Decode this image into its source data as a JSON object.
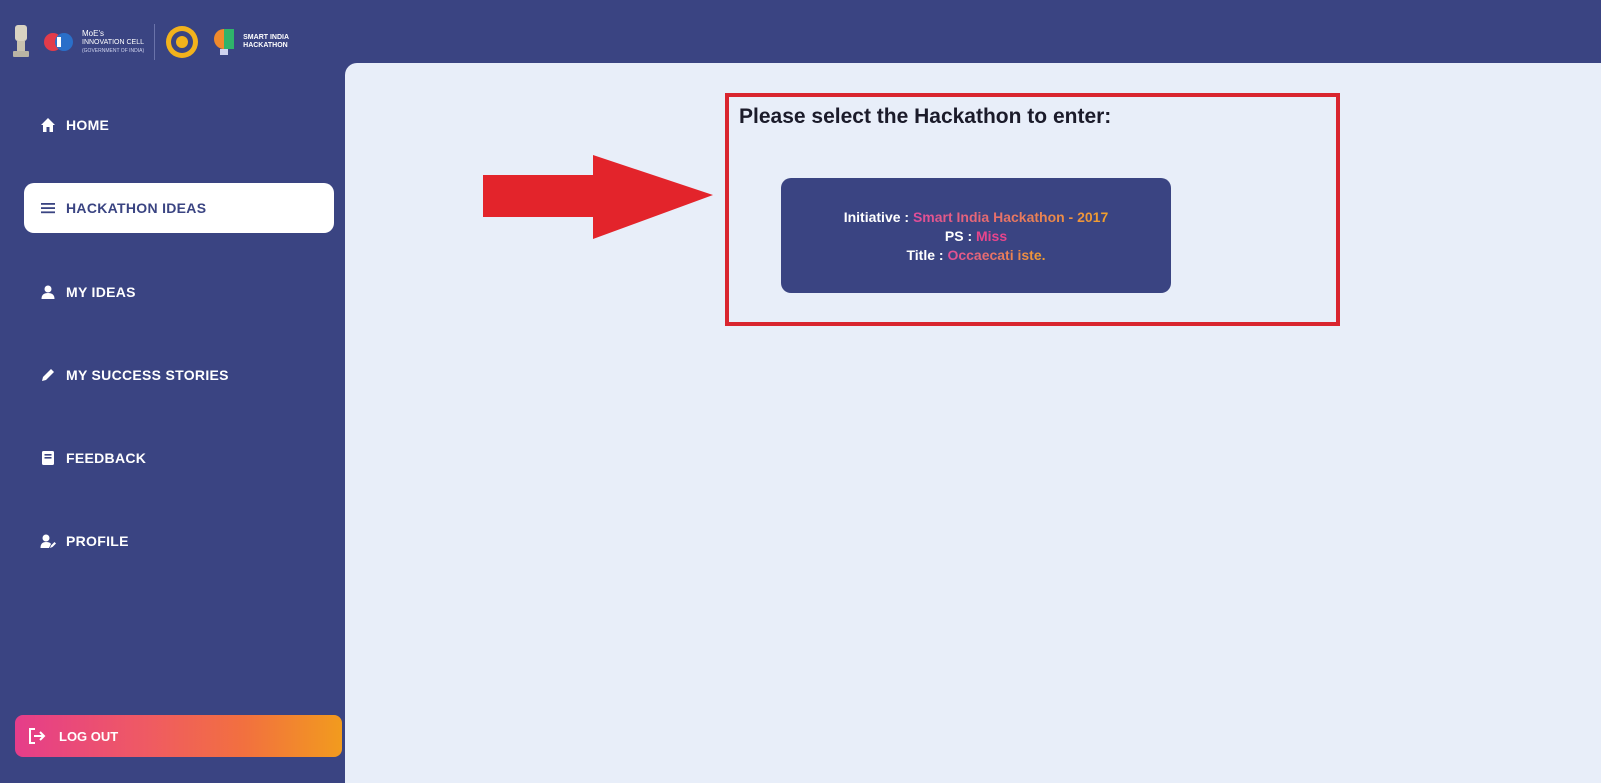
{
  "header": {
    "logos": {
      "moe_line1": "MoE's",
      "moe_line2": "INNOVATION CELL",
      "moe_line3": "(GOVERNMENT OF INDIA)",
      "sih_line1": "SMART INDIA",
      "sih_line2": "HACKATHON"
    }
  },
  "sidebar": {
    "items": [
      {
        "label": "HOME",
        "icon": "home-icon"
      },
      {
        "label": "HACKATHON IDEAS",
        "icon": "menu-icon",
        "active": true
      },
      {
        "label": "MY IDEAS",
        "icon": "user-icon"
      },
      {
        "label": "MY SUCCESS STORIES",
        "icon": "pencil-icon"
      },
      {
        "label": "FEEDBACK",
        "icon": "book-icon"
      },
      {
        "label": "PROFILE",
        "icon": "user-edit-icon"
      }
    ],
    "logout_label": "LOG OUT"
  },
  "main": {
    "prompt": "Please select the Hackathon to enter:",
    "card": {
      "initiative_label": "Initiative :",
      "initiative_value": "Smart India Hackathon - 2017",
      "ps_label": "PS :",
      "ps_value": "Miss",
      "title_label": "Title :",
      "title_value": "Occaecati iste."
    }
  },
  "colors": {
    "primary": "#3a4482",
    "content_bg": "#e8eef9",
    "highlight": "#d9252f",
    "accent_pink": "#e8458c",
    "accent_orange": "#f29b1e"
  }
}
